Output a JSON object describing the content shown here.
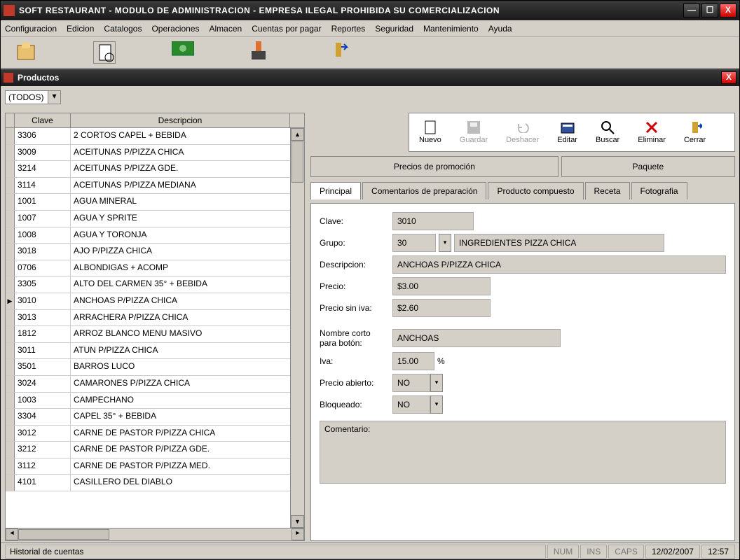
{
  "window": {
    "title": "SOFT RESTAURANT  -  MODULO DE ADMINISTRACION - EMPRESA ILEGAL PROHIBIDA SU COMERCIALIZACION"
  },
  "menubar": [
    "Configuracion",
    "Edicion",
    "Catalogos",
    "Operaciones",
    "Almacen",
    "Cuentas por pagar",
    "Reportes",
    "Seguridad",
    "Mantenimiento",
    "Ayuda"
  ],
  "child": {
    "title": "Productos"
  },
  "filter": {
    "value": "(TODOS)"
  },
  "grid": {
    "headers": {
      "clave": "Clave",
      "descripcion": "Descripcion"
    },
    "rows": [
      {
        "clave": "3306",
        "desc": "2 CORTOS CAPEL + BEBIDA"
      },
      {
        "clave": "3009",
        "desc": "ACEITUNAS P/PIZZA CHICA"
      },
      {
        "clave": "3214",
        "desc": "ACEITUNAS P/PIZZA GDE."
      },
      {
        "clave": "3114",
        "desc": "ACEITUNAS P/PIZZA MEDIANA"
      },
      {
        "clave": "1001",
        "desc": "AGUA MINERAL"
      },
      {
        "clave": "1007",
        "desc": "AGUA Y SPRITE"
      },
      {
        "clave": "1008",
        "desc": "AGUA Y TORONJA"
      },
      {
        "clave": "3018",
        "desc": "AJO P/PIZZA CHICA"
      },
      {
        "clave": "0706",
        "desc": "ALBONDIGAS + ACOMP"
      },
      {
        "clave": "3305",
        "desc": "ALTO DEL CARMEN 35° + BEBIDA"
      },
      {
        "clave": "3010",
        "desc": "ANCHOAS P/PIZZA CHICA",
        "selected": true
      },
      {
        "clave": "3013",
        "desc": "ARRACHERA P/PIZZA CHICA"
      },
      {
        "clave": "1812",
        "desc": "ARROZ BLANCO MENU MASIVO"
      },
      {
        "clave": "3011",
        "desc": "ATUN P/PIZZA CHICA"
      },
      {
        "clave": "3501",
        "desc": "BARROS LUCO"
      },
      {
        "clave": "3024",
        "desc": "CAMARONES P/PIZZA CHICA"
      },
      {
        "clave": "1003",
        "desc": "CAMPECHANO"
      },
      {
        "clave": "3304",
        "desc": "CAPEL 35° + BEBIDA"
      },
      {
        "clave": "3012",
        "desc": "CARNE DE PASTOR P/PIZZA CHICA"
      },
      {
        "clave": "3212",
        "desc": "CARNE DE PASTOR P/PIZZA GDE."
      },
      {
        "clave": "3112",
        "desc": "CARNE DE PASTOR P/PIZZA MED."
      },
      {
        "clave": "4101",
        "desc": "CASILLERO DEL DIABLO"
      }
    ]
  },
  "toolbar": {
    "nuevo": "Nuevo",
    "guardar": "Guardar",
    "deshacer": "Deshacer",
    "editar": "Editar",
    "buscar": "Buscar",
    "eliminar": "Eliminar",
    "cerrar": "Cerrar"
  },
  "promo": {
    "precios": "Precios de promoción",
    "paquete": "Paquete"
  },
  "tabs": {
    "principal": "Principal",
    "comentarios": "Comentarios de preparación",
    "compuesto": "Producto compuesto",
    "receta": "Receta",
    "fotografia": "Fotografia"
  },
  "form": {
    "labels": {
      "clave": "Clave:",
      "grupo": "Grupo:",
      "descripcion": "Descripcion:",
      "precio": "Precio:",
      "precio_sin_iva": "Precio sin iva:",
      "nombre_corto": "Nombre corto para botón:",
      "iva": "Iva:",
      "precio_abierto": "Precio abierto:",
      "bloqueado": "Bloqueado:",
      "comentario": "Comentario:"
    },
    "clave": "3010",
    "grupo_code": "30",
    "grupo_desc": "INGREDIENTES PIZZA CHICA",
    "descripcion": "ANCHOAS P/PIZZA CHICA",
    "precio": "$3.00",
    "precio_sin_iva": "$2.60",
    "nombre_corto": "ANCHOAS",
    "iva": "15.00",
    "pct": "%",
    "precio_abierto": "NO",
    "bloqueado": "NO",
    "comentario": ""
  },
  "statusbar": {
    "left": "Historial de cuentas",
    "num": "NUM",
    "ins": "INS",
    "caps": "CAPS",
    "date": "12/02/2007",
    "time": "12:57"
  }
}
